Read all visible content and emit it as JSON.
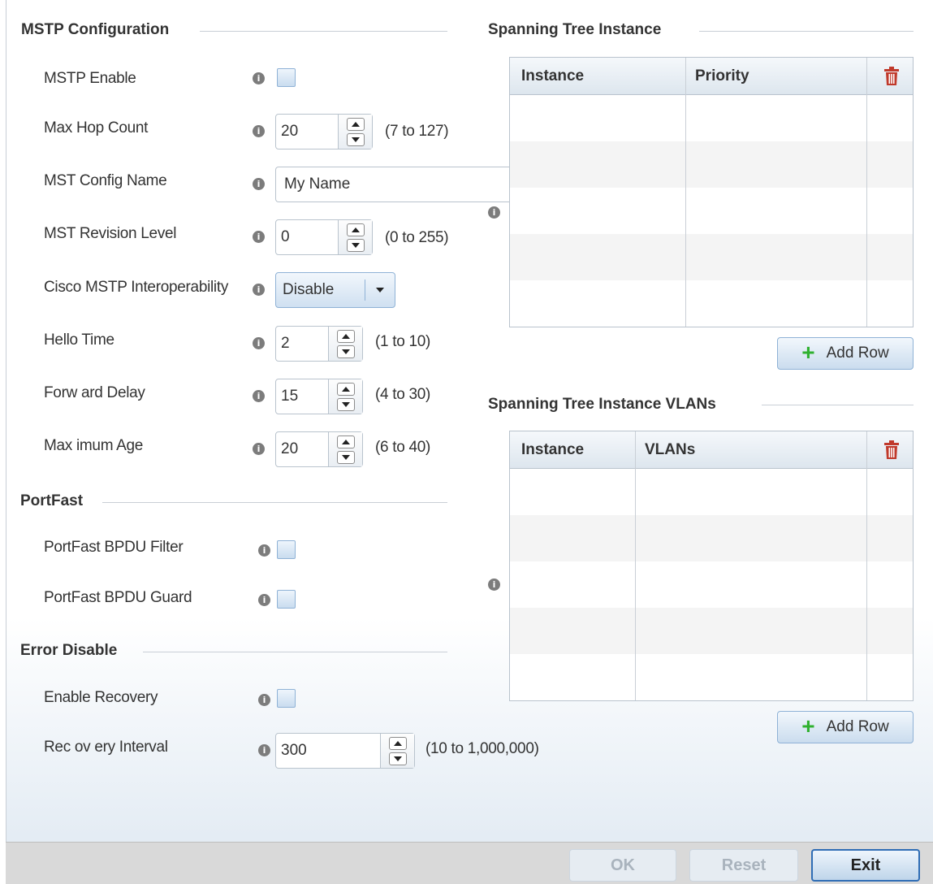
{
  "sections": {
    "mstp": "MSTP Configuration",
    "portfast": "PortFast",
    "error_disable": "Error Disable",
    "sti": "Spanning Tree Instance",
    "sti_vlans": "Spanning Tree Instance VLANs"
  },
  "info_glyph": "i",
  "fields": {
    "mstp_enable": {
      "label": "MSTP Enable",
      "checked": false
    },
    "max_hop_count": {
      "label": "Max Hop Count",
      "value": "20",
      "range": "(7 to 127)"
    },
    "mst_config_name": {
      "label": "MST Config Name",
      "value": "My Name"
    },
    "mst_revision_level": {
      "label": "MST Revision Level",
      "value": "0",
      "range": "(0 to 255)"
    },
    "cisco_interop": {
      "label": "Cisco MSTP Interoperability",
      "value": "Disable"
    },
    "hello_time": {
      "label": "Hello Time",
      "value": "2",
      "range": "(1 to 10)"
    },
    "forward_delay": {
      "label": "Forw ard Delay",
      "value": "15",
      "range": "(4 to 30)"
    },
    "maximum_age": {
      "label": "Max imum Age",
      "value": "20",
      "range": "(6 to 40)"
    },
    "portfast_bpdu_filter": {
      "label": "PortFast BPDU Filter",
      "checked": false
    },
    "portfast_bpdu_guard": {
      "label": "PortFast BPDU Guard",
      "checked": false
    },
    "enable_recovery": {
      "label": "Enable Recovery",
      "checked": false
    },
    "recovery_interval": {
      "label": "Rec ov ery Interval",
      "value": "300",
      "range": "(10 to 1,000,000)"
    }
  },
  "sti_table": {
    "columns": [
      "Instance",
      "Priority"
    ],
    "rows": [],
    "add_row_label": "Add Row"
  },
  "sti_vlans_table": {
    "columns": [
      "Instance",
      "VLANs"
    ],
    "rows": [],
    "add_row_label": "Add Row"
  },
  "footer": {
    "ok": "OK",
    "reset": "Reset",
    "exit": "Exit"
  },
  "colors": {
    "accent_border": "#2f6db5",
    "trash": "#c0392b",
    "plus": "#2fb12f"
  }
}
